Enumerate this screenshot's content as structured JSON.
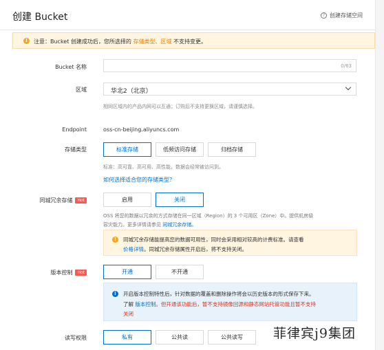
{
  "header": {
    "title": "创建 Bucket",
    "help_text": "创建存储空间",
    "help_icon": "question-circle-icon"
  },
  "notice": {
    "prefix": "注意：Bucket 创建成功后，您所选择的 ",
    "highlight": "存储类型、区域",
    "suffix": " 不支持变更。"
  },
  "bucket_name": {
    "label": "Bucket 名称",
    "value": "",
    "counter": "0/63"
  },
  "region": {
    "label": "区域",
    "selected": "华北2（北京）",
    "hint": "相同区域内的产品内网可以互通；订购后不支持更换区域，请谨慎选择。"
  },
  "endpoint": {
    "label": "Endpoint",
    "value": "oss-cn-beijing.aliyuncs.com"
  },
  "storage_class": {
    "label": "存储类型",
    "options": [
      "标准存储",
      "低频访问存储",
      "归档存储"
    ],
    "selected": "标准存储",
    "hint": "标准：高可靠、高可用、高性能，数据会经常被访问到。",
    "help_link": "如何选择适合您的存储类型？"
  },
  "zone_redundancy": {
    "label": "同城冗余存储",
    "badge": "Hot",
    "options": [
      "启用",
      "关闭"
    ],
    "selected": "关闭",
    "desc_line1": "OSS 将您的数据以冗余的方式存储在同一区域（Region）的 3 个可用区（Zone）中。提供机房级",
    "desc_line2_prefix": "容灾能力。更多详情请参见 ",
    "desc_link": "同城冗余存储。",
    "warn_line1": "同城冗余存储能提高您的数据可用性，同时会采用相对较高的计费标准。请查看",
    "warn_link": "价格详情",
    "warn_line2_suffix": "。同城冗余存储属性开启后，将不支持关闭。"
  },
  "versioning": {
    "label": "版本控制",
    "badge": "Hot",
    "options": [
      "开通",
      "不开通"
    ],
    "selected": "开通",
    "info_line1": "开启版本控制特性后，针对数据的覆盖和删除操作将会以历史版本的形式保存下来。",
    "info_line2_prefix": "了解 ",
    "info_link": "版本控制",
    "info_line2_red": "。但开通该功能后，暂不支持镜像回源和静态网站托管功能且暂不支持",
    "info_line3": "关闭"
  },
  "acl": {
    "label": "读写权限",
    "options": [
      "私有",
      "公共读",
      "公共读写"
    ],
    "selected": "私有"
  },
  "watermark": "菲律宾j9集团",
  "colors": {
    "primary": "#0070cc",
    "warning": "#f5a623",
    "hot": "#f25c54"
  }
}
